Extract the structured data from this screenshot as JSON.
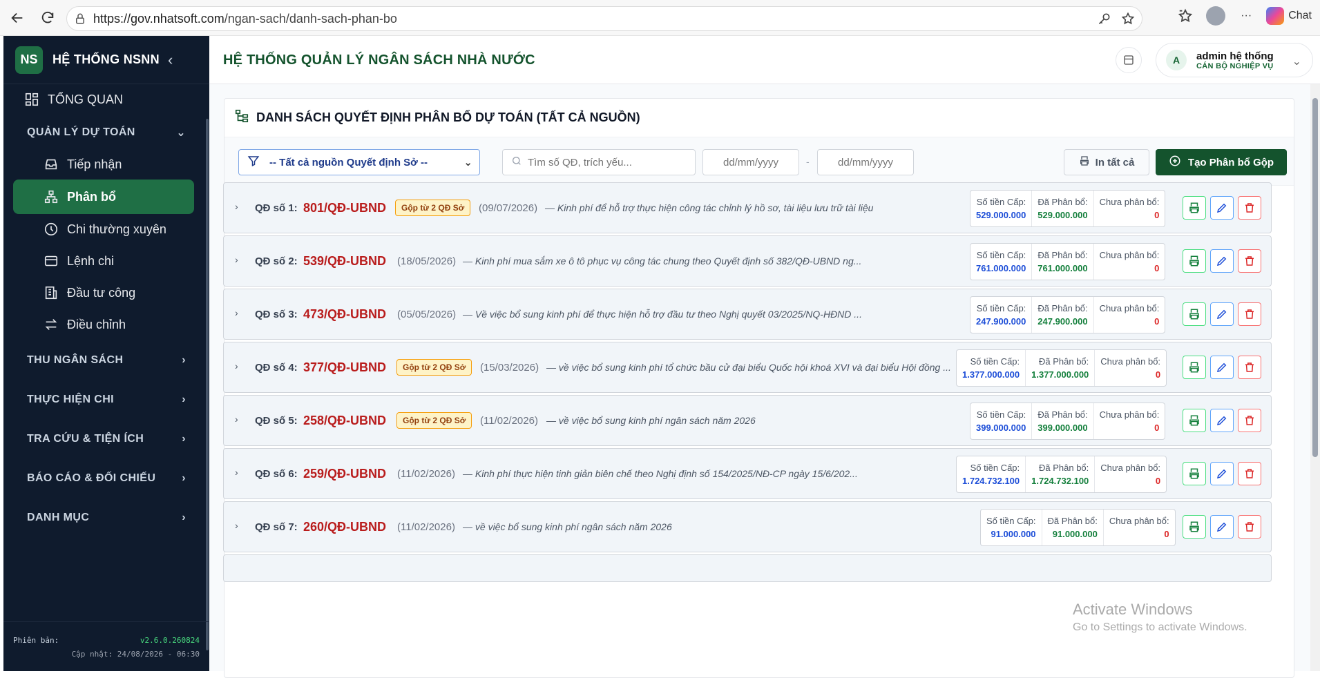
{
  "browser": {
    "url_host": "https://gov.nhatsoft.com",
    "url_path": "/ngan-sach/danh-sach-phan-bo",
    "chat_label": "Chat"
  },
  "sidebar": {
    "logo": "NS",
    "title": "HỆ THỐNG NSNN",
    "overview": "TỔNG QUAN",
    "section_budget": "QUẢN LÝ DỰ TOÁN",
    "items": [
      {
        "label": "Tiếp nhận"
      },
      {
        "label": "Phân bổ"
      },
      {
        "label": "Chi thường xuyên"
      },
      {
        "label": "Lệnh chi"
      },
      {
        "label": "Đầu tư công"
      },
      {
        "label": "Điều chỉnh"
      }
    ],
    "sections": [
      {
        "label": "THU NGÂN SÁCH"
      },
      {
        "label": "THỰC HIỆN CHI"
      },
      {
        "label": "TRA CỨU & TIỆN ÍCH"
      },
      {
        "label": "BÁO CÁO & ĐỐI CHIẾU"
      },
      {
        "label": "DANH MỤC"
      }
    ],
    "version_label": "Phiên bản:",
    "version": "v2.6.0.260824",
    "updated": "Cập nhật: 24/08/2026 - 06:30"
  },
  "header": {
    "title": "HỆ THỐNG QUẢN LÝ NGÂN SÁCH NHÀ NƯỚC",
    "user_initial": "A",
    "user_name": "admin hệ thống",
    "user_role": "CÁN BỘ NGHIỆP VỤ"
  },
  "panel": {
    "title": "DANH SÁCH QUYẾT ĐỊNH PHÂN BỔ DỰ TOÁN (TẤT CẢ NGUỒN)",
    "filter_select": "-- Tất cả nguồn Quyết định Sở --",
    "search_placeholder": "Tìm số QĐ, trích yếu...",
    "date_placeholder": "dd/mm/yyyy",
    "date_sep": "-",
    "print_all": "In tất cả",
    "create": "Tạo Phân bổ Gộp"
  },
  "money_labels": {
    "cap": "Số tiền Cấp:",
    "allocated": "Đã Phân bổ:",
    "remaining": "Chưa phân bổ:"
  },
  "rows": [
    {
      "label": "QĐ số 1:",
      "no": "801/QĐ-UBND",
      "badge": "Gộp từ 2 QĐ Sở",
      "date": "(09/07/2026)",
      "desc": "— Kinh phí để hỗ trợ thực hiện công tác chỉnh lý hồ sơ, tài liệu lưu trữ tài liệu",
      "cap": "529.000.000",
      "allocated": "529.000.000",
      "remaining": "0"
    },
    {
      "label": "QĐ số 2:",
      "no": "539/QĐ-UBND",
      "badge": "",
      "date": "(18/05/2026)",
      "desc": "— Kinh phí mua sắm xe ô tô phục vụ công tác chung theo Quyết định số 382/QĐ-UBND ng...",
      "cap": "761.000.000",
      "allocated": "761.000.000",
      "remaining": "0"
    },
    {
      "label": "QĐ số 3:",
      "no": "473/QĐ-UBND",
      "badge": "",
      "date": "(05/05/2026)",
      "desc": "— Về việc bổ sung kinh phí để thực hiện hỗ trợ đầu tư theo Nghị quyết 03/2025/NQ-HĐND ...",
      "cap": "247.900.000",
      "allocated": "247.900.000",
      "remaining": "0"
    },
    {
      "label": "QĐ số 4:",
      "no": "377/QĐ-UBND",
      "badge": "Gộp từ 2 QĐ Sở",
      "date": "(15/03/2026)",
      "desc": "— về việc bổ sung kinh phí tổ chức bầu cử đại biểu Quốc hội khoá XVI và đại biểu Hội đồng ...",
      "cap": "1.377.000.000",
      "allocated": "1.377.000.000",
      "remaining": "0"
    },
    {
      "label": "QĐ số 5:",
      "no": "258/QĐ-UBND",
      "badge": "Gộp từ 2 QĐ Sở",
      "date": "(11/02/2026)",
      "desc": "— về việc bổ sung kinh phí ngân sách năm 2026",
      "cap": "399.000.000",
      "allocated": "399.000.000",
      "remaining": "0"
    },
    {
      "label": "QĐ số 6:",
      "no": "259/QĐ-UBND",
      "badge": "",
      "date": "(11/02/2026)",
      "desc": "— Kinh phí thực hiện tinh giản biên chế theo Nghị định số 154/2025/NĐ-CP ngày 15/6/202...",
      "cap": "1.724.732.100",
      "allocated": "1.724.732.100",
      "remaining": "0"
    },
    {
      "label": "QĐ số 7:",
      "no": "260/QĐ-UBND",
      "badge": "",
      "date": "(11/02/2026)",
      "desc": "— về việc bổ sung kinh phí ngân sách năm 2026",
      "cap": "91.000.000",
      "allocated": "91.000.000",
      "remaining": "0"
    }
  ],
  "watermark": {
    "line1": "Activate Windows",
    "line2": "Go to Settings to activate Windows."
  },
  "colors": {
    "sidebar_bg": "#0f1b2d",
    "brand_green": "#14532d",
    "active_green": "#1f6f45",
    "qd_red": "#b91c1c"
  }
}
